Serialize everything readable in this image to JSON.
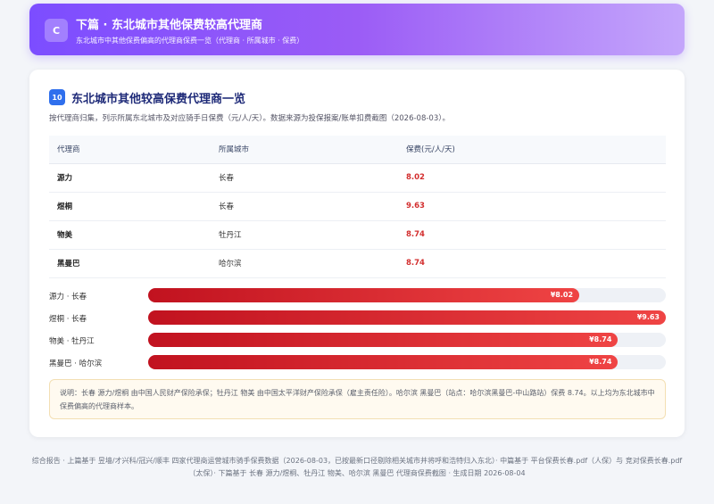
{
  "header": {
    "badge": "C",
    "title": "下篇 · 东北城市其他保费较高代理商",
    "subtitle": "东北城市中其他保费偏高的代理商保费一览（代理商 · 所属城市 · 保费）"
  },
  "section": {
    "number": "10",
    "title": "东北城市其他较高保费代理商一览",
    "desc": "按代理商归集，列示所属东北城市及对应骑手日保费（元/人/天）。数据来源为投保报案/账单扣费截图（2026-08-03）。"
  },
  "table": {
    "headers": [
      "代理商",
      "所属城市",
      "保费(元/人/天)"
    ],
    "rows": [
      {
        "agent": "源力",
        "city": "长春",
        "price": "8.02"
      },
      {
        "agent": "煜桐",
        "city": "长春",
        "price": "9.63"
      },
      {
        "agent": "物美",
        "city": "牡丹江",
        "price": "8.74"
      },
      {
        "agent": "黑曼巴",
        "city": "哈尔滨",
        "price": "8.74"
      }
    ]
  },
  "chart_data": {
    "type": "bar",
    "orientation": "horizontal",
    "categories": [
      "源力 · 长春",
      "煜桐 · 长春",
      "物美 · 牡丹江",
      "黑曼巴 · 哈尔滨"
    ],
    "values": [
      8.02,
      9.63,
      8.74,
      8.74
    ],
    "value_labels": [
      "¥8.02",
      "¥9.63",
      "¥8.74",
      "¥8.74"
    ],
    "xlim": [
      0,
      9.63
    ],
    "bar_color": "#d32f2f"
  },
  "note": "说明：长春 源力/煜桐 由中国人民财产保险承保；牡丹江 物美 由中国太平洋财产保险承保（雇主责任险）。哈尔滨 黑曼巴（站点：哈尔滨黑曼巴-中山路站）保费 8.74。以上均为东北城市中保费偏高的代理商样本。",
  "footer": "综合报告 · 上篇基于 昱墙/才兴科/冠兴/顺丰 四家代理商运营城市骑手保费数据（2026-08-03，已按最新口径剔除相关城市并将呼和浩特归入东北）· 中篇基于 平台保费长春.pdf（人保）与 竞对保费长春.pdf（太保）· 下篇基于 长春 源力/煜桐、牡丹江 物美、哈尔滨 黑曼巴 代理商保费截图 · 生成日期 2026-08-04",
  "colors": {
    "header_gradient_start": "#7c4dff",
    "header_gradient_end": "#c4a6fb",
    "section_badge": "#2f6fed",
    "section_title": "#1e2a78",
    "price_red": "#d32f2f"
  }
}
